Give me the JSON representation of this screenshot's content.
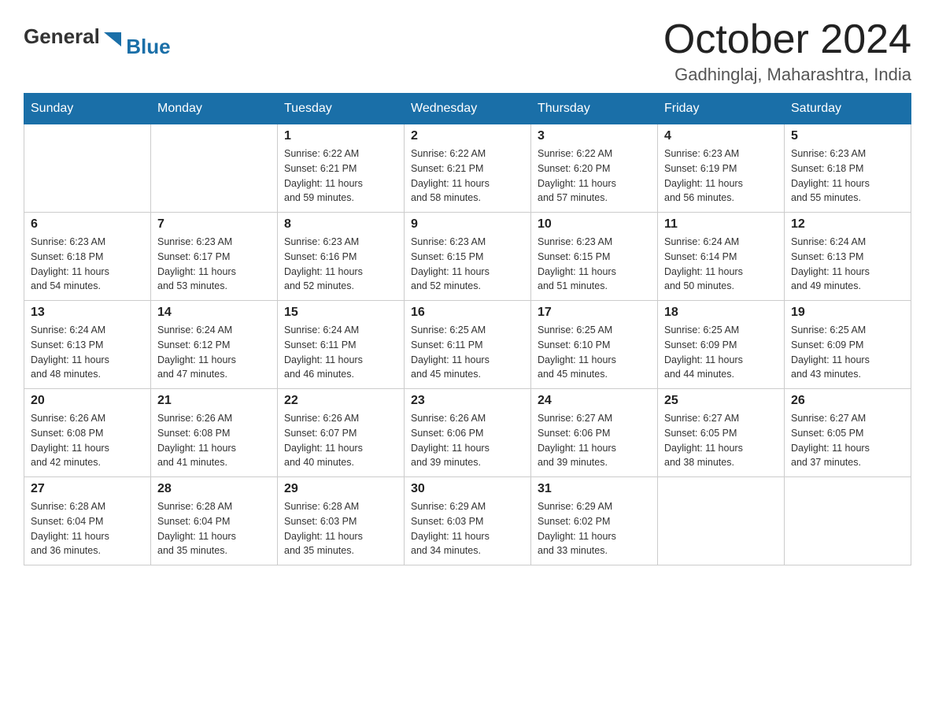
{
  "logo": {
    "general": "General",
    "blue": "Blue"
  },
  "title": "October 2024",
  "subtitle": "Gadhinglaj, Maharashtra, India",
  "weekdays": [
    "Sunday",
    "Monday",
    "Tuesday",
    "Wednesday",
    "Thursday",
    "Friday",
    "Saturday"
  ],
  "weeks": [
    [
      {
        "day": "",
        "info": ""
      },
      {
        "day": "",
        "info": ""
      },
      {
        "day": "1",
        "info": "Sunrise: 6:22 AM\nSunset: 6:21 PM\nDaylight: 11 hours\nand 59 minutes."
      },
      {
        "day": "2",
        "info": "Sunrise: 6:22 AM\nSunset: 6:21 PM\nDaylight: 11 hours\nand 58 minutes."
      },
      {
        "day": "3",
        "info": "Sunrise: 6:22 AM\nSunset: 6:20 PM\nDaylight: 11 hours\nand 57 minutes."
      },
      {
        "day": "4",
        "info": "Sunrise: 6:23 AM\nSunset: 6:19 PM\nDaylight: 11 hours\nand 56 minutes."
      },
      {
        "day": "5",
        "info": "Sunrise: 6:23 AM\nSunset: 6:18 PM\nDaylight: 11 hours\nand 55 minutes."
      }
    ],
    [
      {
        "day": "6",
        "info": "Sunrise: 6:23 AM\nSunset: 6:18 PM\nDaylight: 11 hours\nand 54 minutes."
      },
      {
        "day": "7",
        "info": "Sunrise: 6:23 AM\nSunset: 6:17 PM\nDaylight: 11 hours\nand 53 minutes."
      },
      {
        "day": "8",
        "info": "Sunrise: 6:23 AM\nSunset: 6:16 PM\nDaylight: 11 hours\nand 52 minutes."
      },
      {
        "day": "9",
        "info": "Sunrise: 6:23 AM\nSunset: 6:15 PM\nDaylight: 11 hours\nand 52 minutes."
      },
      {
        "day": "10",
        "info": "Sunrise: 6:23 AM\nSunset: 6:15 PM\nDaylight: 11 hours\nand 51 minutes."
      },
      {
        "day": "11",
        "info": "Sunrise: 6:24 AM\nSunset: 6:14 PM\nDaylight: 11 hours\nand 50 minutes."
      },
      {
        "day": "12",
        "info": "Sunrise: 6:24 AM\nSunset: 6:13 PM\nDaylight: 11 hours\nand 49 minutes."
      }
    ],
    [
      {
        "day": "13",
        "info": "Sunrise: 6:24 AM\nSunset: 6:13 PM\nDaylight: 11 hours\nand 48 minutes."
      },
      {
        "day": "14",
        "info": "Sunrise: 6:24 AM\nSunset: 6:12 PM\nDaylight: 11 hours\nand 47 minutes."
      },
      {
        "day": "15",
        "info": "Sunrise: 6:24 AM\nSunset: 6:11 PM\nDaylight: 11 hours\nand 46 minutes."
      },
      {
        "day": "16",
        "info": "Sunrise: 6:25 AM\nSunset: 6:11 PM\nDaylight: 11 hours\nand 45 minutes."
      },
      {
        "day": "17",
        "info": "Sunrise: 6:25 AM\nSunset: 6:10 PM\nDaylight: 11 hours\nand 45 minutes."
      },
      {
        "day": "18",
        "info": "Sunrise: 6:25 AM\nSunset: 6:09 PM\nDaylight: 11 hours\nand 44 minutes."
      },
      {
        "day": "19",
        "info": "Sunrise: 6:25 AM\nSunset: 6:09 PM\nDaylight: 11 hours\nand 43 minutes."
      }
    ],
    [
      {
        "day": "20",
        "info": "Sunrise: 6:26 AM\nSunset: 6:08 PM\nDaylight: 11 hours\nand 42 minutes."
      },
      {
        "day": "21",
        "info": "Sunrise: 6:26 AM\nSunset: 6:08 PM\nDaylight: 11 hours\nand 41 minutes."
      },
      {
        "day": "22",
        "info": "Sunrise: 6:26 AM\nSunset: 6:07 PM\nDaylight: 11 hours\nand 40 minutes."
      },
      {
        "day": "23",
        "info": "Sunrise: 6:26 AM\nSunset: 6:06 PM\nDaylight: 11 hours\nand 39 minutes."
      },
      {
        "day": "24",
        "info": "Sunrise: 6:27 AM\nSunset: 6:06 PM\nDaylight: 11 hours\nand 39 minutes."
      },
      {
        "day": "25",
        "info": "Sunrise: 6:27 AM\nSunset: 6:05 PM\nDaylight: 11 hours\nand 38 minutes."
      },
      {
        "day": "26",
        "info": "Sunrise: 6:27 AM\nSunset: 6:05 PM\nDaylight: 11 hours\nand 37 minutes."
      }
    ],
    [
      {
        "day": "27",
        "info": "Sunrise: 6:28 AM\nSunset: 6:04 PM\nDaylight: 11 hours\nand 36 minutes."
      },
      {
        "day": "28",
        "info": "Sunrise: 6:28 AM\nSunset: 6:04 PM\nDaylight: 11 hours\nand 35 minutes."
      },
      {
        "day": "29",
        "info": "Sunrise: 6:28 AM\nSunset: 6:03 PM\nDaylight: 11 hours\nand 35 minutes."
      },
      {
        "day": "30",
        "info": "Sunrise: 6:29 AM\nSunset: 6:03 PM\nDaylight: 11 hours\nand 34 minutes."
      },
      {
        "day": "31",
        "info": "Sunrise: 6:29 AM\nSunset: 6:02 PM\nDaylight: 11 hours\nand 33 minutes."
      },
      {
        "day": "",
        "info": ""
      },
      {
        "day": "",
        "info": ""
      }
    ]
  ]
}
